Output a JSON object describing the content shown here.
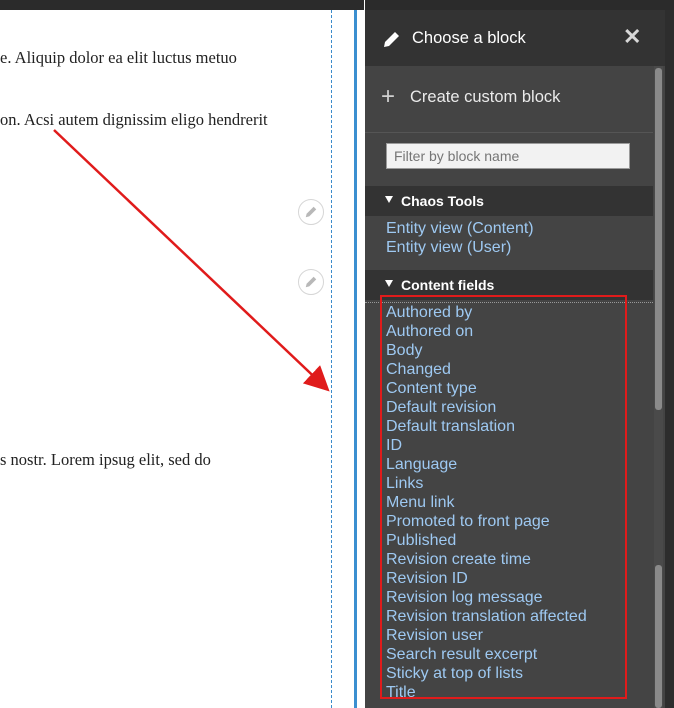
{
  "content": {
    "paragraphs": [
      "e. Aliquip dolor ea elit luctus metuo",
      "on. Acsi autem dignissim eligo hendrerit",
      "s nostr. Lorem ipsug elit, sed do"
    ]
  },
  "panel": {
    "title": "Choose a block",
    "close_symbol": "✕",
    "create_label": "Create custom block",
    "filter_placeholder": "Filter by block name",
    "sections": [
      {
        "label": "Chaos Tools",
        "items": [
          "Entity view (Content)",
          "Entity view (User)"
        ]
      },
      {
        "label": "Content fields",
        "items": [
          "Authored by",
          "Authored on",
          "Body",
          "Changed",
          "Content type",
          "Default revision",
          "Default translation",
          "ID",
          "Language",
          "Links",
          "Menu link",
          "Promoted to front page",
          "Published",
          "Revision create time",
          "Revision ID",
          "Revision log message",
          "Revision translation affected",
          "Revision user",
          "Search result excerpt",
          "Sticky at top of lists",
          "Title"
        ]
      }
    ]
  },
  "colors": {
    "link": "#9ec9f2",
    "panel_bg": "#444444",
    "header_bg": "#333333",
    "annotation": "#e01b1b",
    "region_border": "#3b8fd0"
  }
}
